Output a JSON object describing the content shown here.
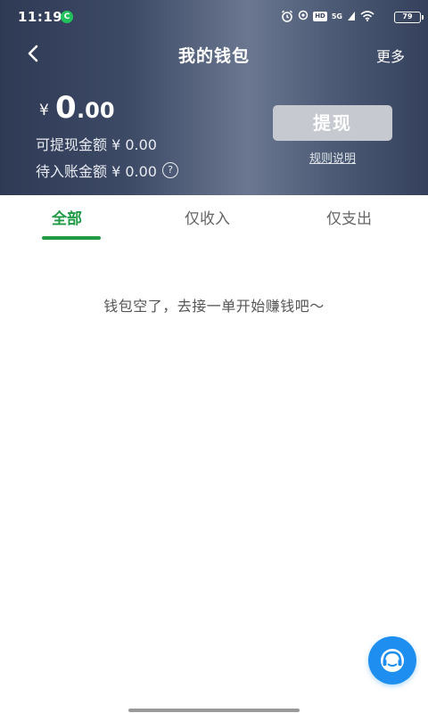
{
  "status_bar": {
    "time": "11:19",
    "app_icon": "green-notification-icon",
    "icons": [
      "alarm-icon",
      "location-icon",
      "hd-badge",
      "5g-signal-icon",
      "wifi-icon"
    ],
    "hd": "HD",
    "network": "5G",
    "battery": "79"
  },
  "nav": {
    "back_icon": "chevron-left-icon",
    "title": "我的钱包",
    "more": "更多"
  },
  "balance": {
    "currency": "¥",
    "integer": "0",
    "decimal": ".00",
    "withdrawable": "可提现金额 ¥ 0.00",
    "pending": "待入账金额 ¥ 0.00",
    "help_icon": "question-circle-icon"
  },
  "actions": {
    "withdraw_label": "提现",
    "rules_label": "规则说明"
  },
  "tabs": [
    {
      "label": "全部",
      "active": true
    },
    {
      "label": "仅收入",
      "active": false
    },
    {
      "label": "仅支出",
      "active": false
    }
  ],
  "empty_state": "钱包空了，去接一单开始赚钱吧～",
  "support_button": {
    "icon": "headset-icon"
  },
  "colors": {
    "header_bg": "#3d4a66",
    "accent_green": "#1f9a45",
    "withdraw_disabled": "#c6c9cf",
    "fab_blue": "#1e8ff0"
  }
}
